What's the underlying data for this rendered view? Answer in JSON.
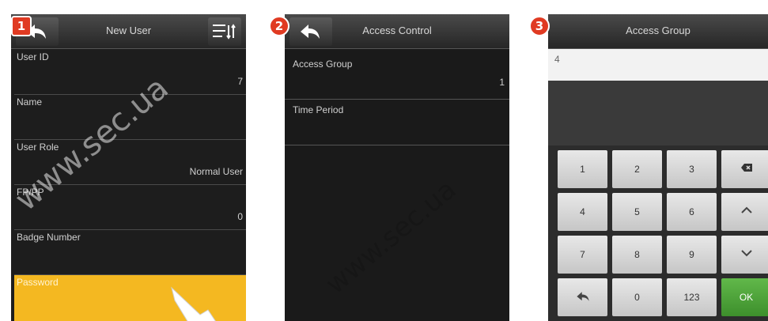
{
  "steps": [
    "1",
    "2",
    "3"
  ],
  "screen1": {
    "title": "New User",
    "fields": [
      {
        "label": "User ID",
        "value": "7"
      },
      {
        "label": "Name",
        "value": ""
      },
      {
        "label": "User Role",
        "value": "Normal User"
      },
      {
        "label": "FP/PP",
        "value": "0"
      },
      {
        "label": "Badge Number",
        "value": ""
      },
      {
        "label": "Password",
        "value": ""
      }
    ]
  },
  "screen2": {
    "title": "Access Control",
    "fields": [
      {
        "label": "Access Group",
        "value": "1"
      },
      {
        "label": "Time Period",
        "value": ""
      }
    ]
  },
  "screen3": {
    "title": "Access Group",
    "input_value": "4",
    "keys": [
      "1",
      "2",
      "3",
      "4",
      "5",
      "6",
      "7",
      "8",
      "9",
      "0",
      "123",
      "OK"
    ]
  },
  "watermark": "www.sec.ua",
  "colors": {
    "highlight": "#f4b821",
    "ok": "#4aa336",
    "badge": "#e03a22"
  }
}
